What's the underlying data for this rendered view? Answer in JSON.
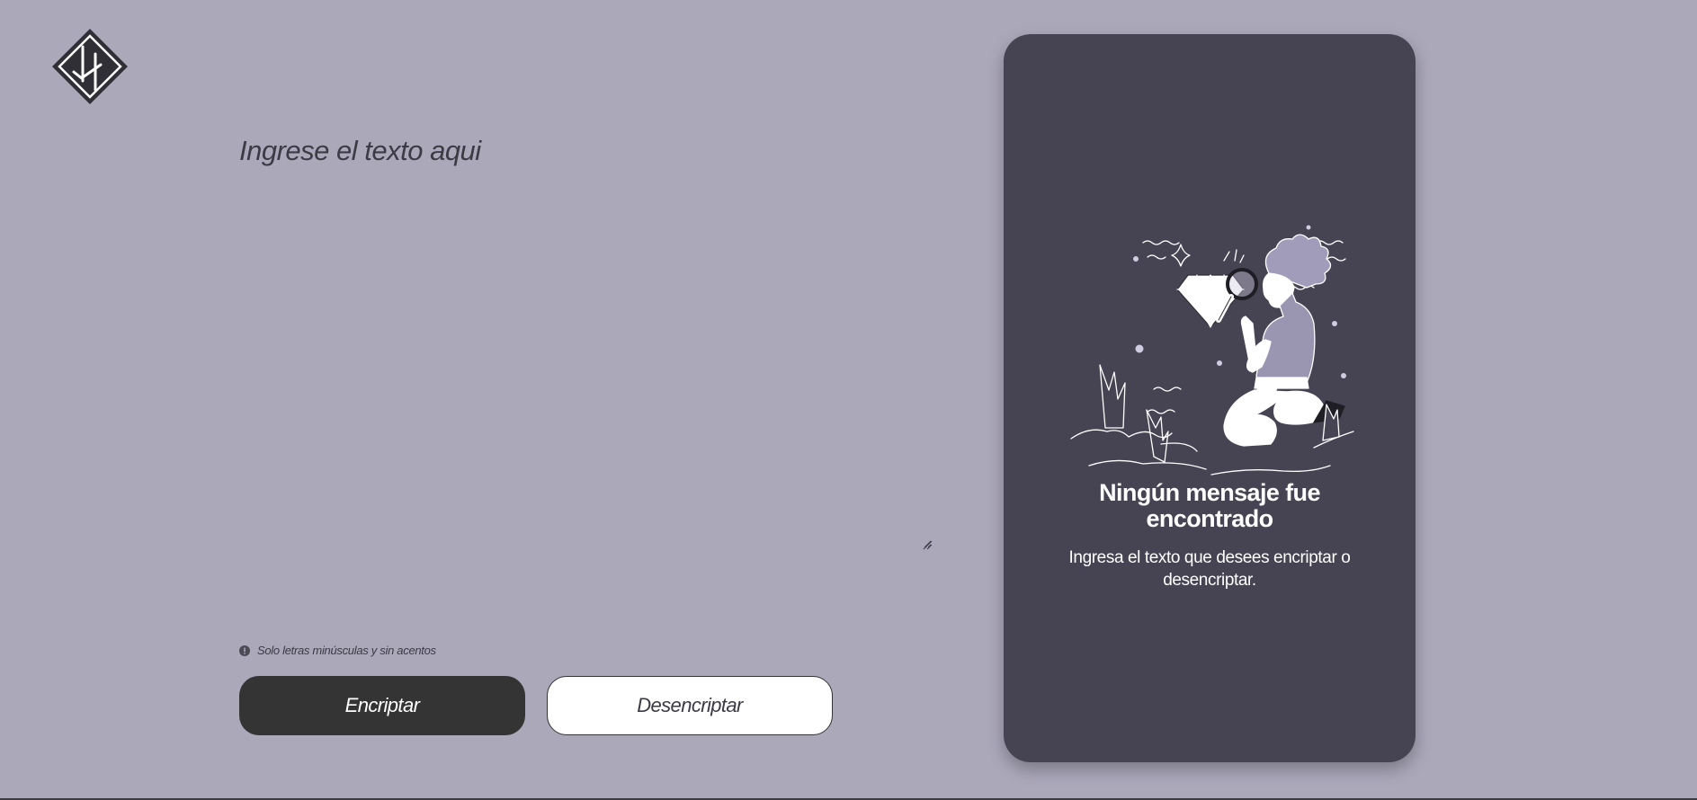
{
  "editor": {
    "placeholder": "Ingrese el texto aqui"
  },
  "hint": {
    "icon": "info-icon",
    "text": "Solo letras minúsculas y sin acentos"
  },
  "buttons": {
    "encrypt_label": "Encriptar",
    "decrypt_label": "Desencriptar"
  },
  "result_panel": {
    "illustration": "person-searching-illustration",
    "title": "Ningún mensaje fue encontrado",
    "description": "Ingresa el texto que desees encriptar o desencriptar."
  },
  "colors": {
    "background": "#aba8ba",
    "panel": "#464453",
    "primary_button": "#343434",
    "secondary_button": "#ffffff"
  }
}
